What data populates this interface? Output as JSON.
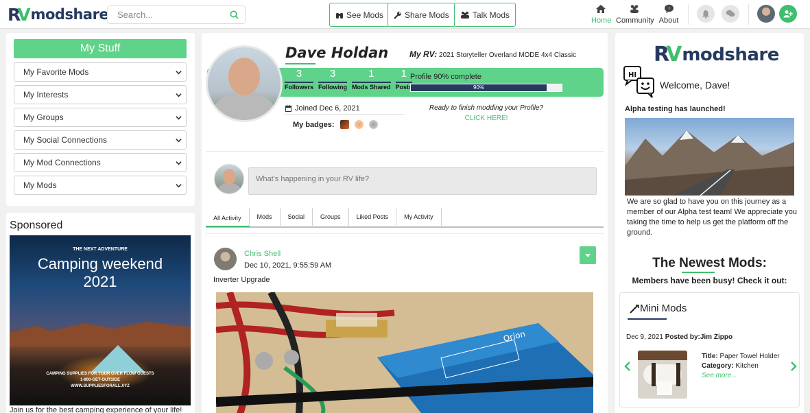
{
  "brand": {
    "name": "modshare",
    "mark_r": "R",
    "mark_v": "V"
  },
  "search": {
    "placeholder": "Search..."
  },
  "nav": {
    "see_mods": "See Mods",
    "share_mods": "Share Mods",
    "talk_mods": "Talk Mods",
    "home": "Home",
    "community": "Community",
    "about": "About"
  },
  "colors": {
    "accent": "#3fbf6e",
    "accent_light": "#5fd38a",
    "navy": "#26395e"
  },
  "sidebar": {
    "title": "My Stuff",
    "items": [
      {
        "label": "My Favorite Mods"
      },
      {
        "label": "My Interests"
      },
      {
        "label": "My Groups"
      },
      {
        "label": "My Social Connections"
      },
      {
        "label": "My Mod Connections"
      },
      {
        "label": "My Mods"
      }
    ]
  },
  "sponsored": {
    "label": "Sponsored",
    "ad_kicker": "THE NEXT ADVENTURE",
    "ad_title_1": "Camping weekend",
    "ad_title_2": "2021",
    "ad_line_1": "CAMPING SUPPLIES FOR YOUR OVER FLOW GUESTS",
    "ad_line_2": "1-800-GET-OUTSIDE",
    "ad_line_3": "WWW.SUPPLIESFORALL.XYZ",
    "caption": "Join us for the best camping experience of your life!"
  },
  "profile": {
    "name": "Dave Holdan",
    "rv_label": "My RV:",
    "rv_value": "2021 Storyteller Overland MODE 4x4 Classic",
    "stats": [
      {
        "value": "3",
        "label": "Followers"
      },
      {
        "value": "3",
        "label": "Following"
      },
      {
        "value": "1",
        "label": "Mods Shared"
      },
      {
        "value": "1",
        "label": "Posts"
      }
    ],
    "progress_label": "Profile 90% complete",
    "progress_value": 0.9,
    "progress_text": "90%",
    "joined": "Joined Dec 6, 2021",
    "badges_label": "My badges:",
    "ready_text": "Ready to finish modding your Profile?",
    "click_here": "CLICK HERE!"
  },
  "composer": {
    "placeholder": "What's happening in your RV life?"
  },
  "tabs": [
    "All Activity",
    "Mods",
    "Social",
    "Groups",
    "Liked Posts",
    "My Activity"
  ],
  "feed": {
    "author": "Chris Shell",
    "date": "Dec 10, 2021, 9:55:59 AM",
    "text": "Inverter Upgrade",
    "device_brand": "Orion"
  },
  "right": {
    "hi": "HI",
    "welcome": "Welcome, Dave!",
    "alpha_title": "Alpha testing has launched!",
    "alpha_text": "We are so glad to have you on this journey as a member of our Alpha test team! We appreciate you taking the time to help us get the platform off the ground.",
    "newest_title": "The Newest Mods:",
    "members_text": "Members have been busy! Check it out:",
    "mini": {
      "title": "Mini Mods",
      "date": "Dec 9, 2021",
      "posted_by_label": "Posted by:",
      "posted_by": "Jim Zippo",
      "title_label": "Title:",
      "title_value": "Paper Towel Holder",
      "category_label": "Category:",
      "category_value": "Kitchen",
      "see_more": "See more..."
    }
  }
}
